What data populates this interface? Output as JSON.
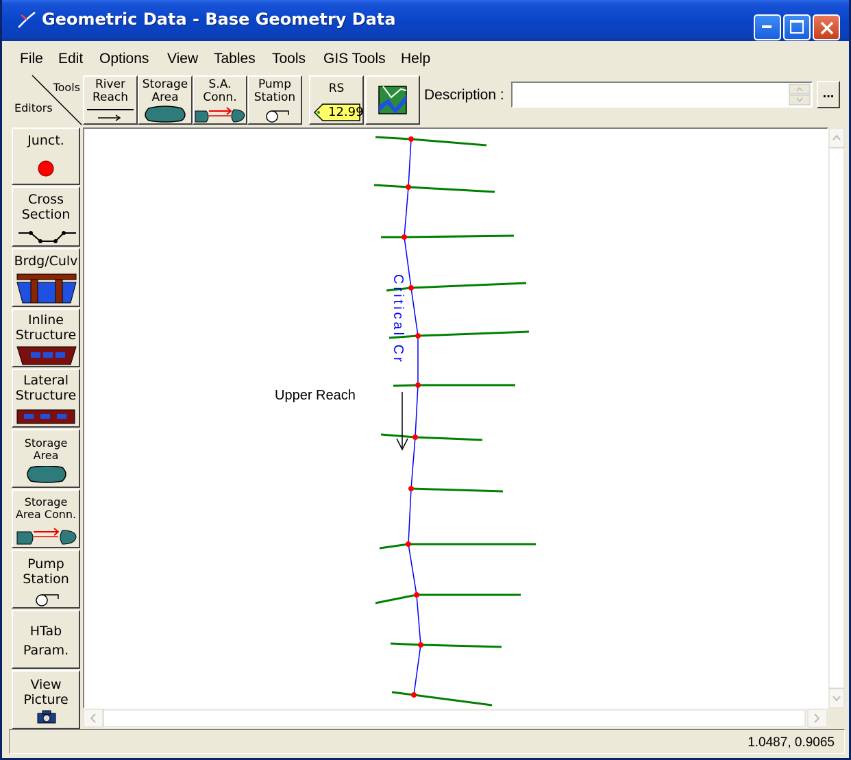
{
  "window": {
    "title": "Geometric Data - Base Geometry Data",
    "controls": {
      "minimize": "_",
      "maximize": "□",
      "close": "✕"
    }
  },
  "menu": [
    "File",
    "Edit",
    "Options",
    "View",
    "Tables",
    "Tools",
    "GIS Tools",
    "Help"
  ],
  "toolbar": {
    "corner_top": "Tools",
    "corner_bottom": "Editors",
    "river_reach": {
      "line1": "River",
      "line2": "Reach"
    },
    "storage_area": {
      "line1": "Storage",
      "line2": "Area"
    },
    "sa_conn": {
      "line1": "S.A.",
      "line2": "Conn."
    },
    "pump_station": {
      "line1": "Pump",
      "line2": "Station"
    },
    "rs": {
      "label": "RS",
      "tag": "12.99"
    },
    "gis_icon": "map-icon",
    "description_label": "Description :",
    "description_value": "",
    "more_button": "..."
  },
  "editors": [
    {
      "line1": "Junct.",
      "line2": ""
    },
    {
      "line1": "Cross",
      "line2": "Section"
    },
    {
      "line1": "Brdg/Culv",
      "line2": ""
    },
    {
      "line1": "Inline",
      "line2": "Structure"
    },
    {
      "line1": "Lateral",
      "line2": "Structure"
    },
    {
      "line1": "Storage",
      "line2": "Area"
    },
    {
      "line1": "Storage",
      "line2": "Area Conn."
    },
    {
      "line1": "Pump",
      "line2": "Station"
    },
    {
      "line1": "HTab",
      "line2": "Param."
    },
    {
      "line1": "View",
      "line2": "Picture"
    }
  ],
  "schematic": {
    "river_label": "Critical Cr",
    "reach_label": "Upper Reach",
    "colors": {
      "river": "#0000ff",
      "cross_section": "#008000",
      "node": "#ff0000"
    }
  },
  "status": {
    "coordinates": "1.0487, 0.9065"
  }
}
